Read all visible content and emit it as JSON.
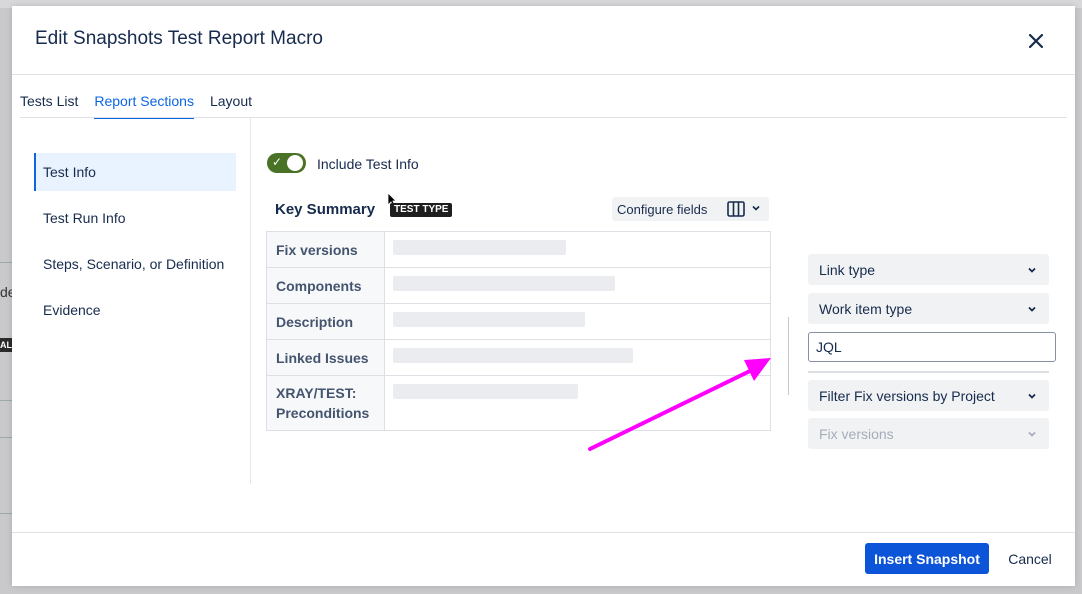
{
  "background": {
    "side_text": "de",
    "badge_text": "AL"
  },
  "modal": {
    "title": "Edit Snapshots Test Report Macro",
    "close_icon": "close-icon"
  },
  "tabs": [
    {
      "label": "Tests List",
      "active": false
    },
    {
      "label": "Report Sections",
      "active": true
    },
    {
      "label": "Layout",
      "active": false
    }
  ],
  "sidebar": {
    "items": [
      {
        "label": "Test Info",
        "active": true
      },
      {
        "label": "Test Run Info",
        "active": false
      },
      {
        "label": "Steps, Scenario, or Definition",
        "active": false
      },
      {
        "label": "Evidence",
        "active": false
      }
    ]
  },
  "section": {
    "toggle_label": "Include Test Info",
    "toggle_on": true,
    "key_summary": "Key Summary",
    "test_type_badge": "TEST TYPE",
    "configure_label": "Configure fields",
    "fields": [
      {
        "label": "Fix versions"
      },
      {
        "label": "Components"
      },
      {
        "label": "Description"
      },
      {
        "label": "Linked Issues"
      },
      {
        "label": "XRAY/TEST: Preconditions"
      }
    ]
  },
  "filters": {
    "link_type": "Link type",
    "work_item_type": "Work item type",
    "jql_value": "JQL",
    "filter_fix_versions": "Filter Fix versions by Project",
    "fix_versions": "Fix versions"
  },
  "footer": {
    "insert_label": "Insert Snapshot",
    "cancel_label": "Cancel"
  },
  "colors": {
    "primary": "#0c55d9",
    "tab_active": "#0c66e4",
    "toggle_on": "#4a7227",
    "annotation_arrow": "#ff00ff"
  }
}
